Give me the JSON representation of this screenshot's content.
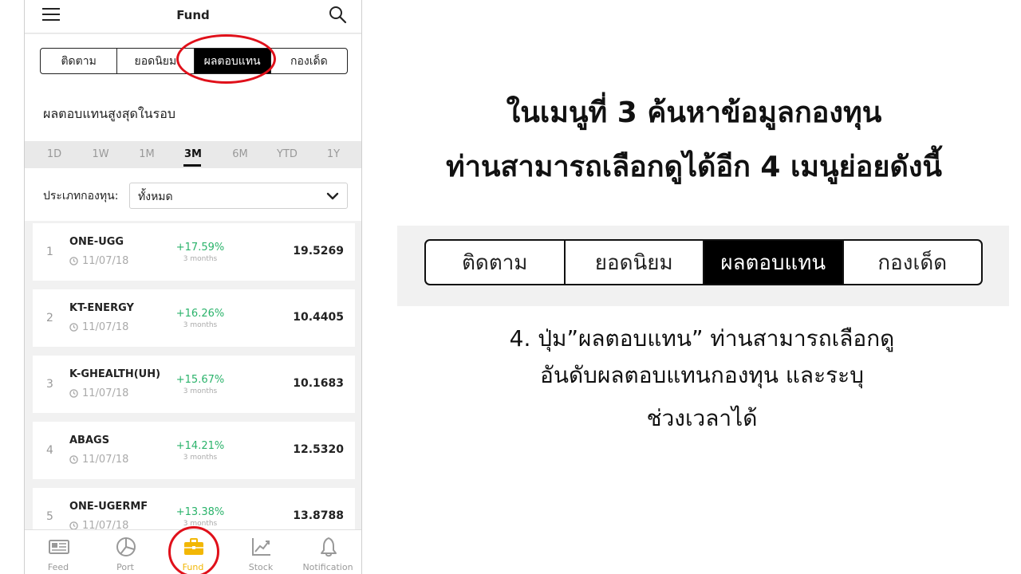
{
  "app": {
    "title": "Fund",
    "tabs": [
      {
        "label": "ติดตาม",
        "active": false
      },
      {
        "label": "ยอดนิยม",
        "active": false
      },
      {
        "label": "ผลตอบแทน",
        "active": true
      },
      {
        "label": "กองเด็ด",
        "active": false
      }
    ],
    "section_title": "ผลตอบแทนสูงสุดในรอบ",
    "periods": [
      {
        "label": "1D",
        "active": false
      },
      {
        "label": "1W",
        "active": false
      },
      {
        "label": "1M",
        "active": false
      },
      {
        "label": "3M",
        "active": true
      },
      {
        "label": "6M",
        "active": false
      },
      {
        "label": "YTD",
        "active": false
      },
      {
        "label": "1Y",
        "active": false
      }
    ],
    "filter": {
      "label": "ประเภทกองทุน:",
      "value": "ทั้งหมด"
    },
    "funds": [
      {
        "rank": "1",
        "name": "ONE-UGG",
        "date": "11/07/18",
        "change": "+17.59%",
        "period": "3 months",
        "nav": "19.5269"
      },
      {
        "rank": "2",
        "name": "KT-ENERGY",
        "date": "11/07/18",
        "change": "+16.26%",
        "period": "3 months",
        "nav": "10.4405"
      },
      {
        "rank": "3",
        "name": "K-GHEALTH(UH)",
        "date": "11/07/18",
        "change": "+15.67%",
        "period": "3 months",
        "nav": "10.1683"
      },
      {
        "rank": "4",
        "name": "ABAGS",
        "date": "11/07/18",
        "change": "+14.21%",
        "period": "3 months",
        "nav": "12.5320"
      },
      {
        "rank": "5",
        "name": "ONE-UGERMF",
        "date": "11/07/18",
        "change": "+13.38%",
        "period": "3 months",
        "nav": "13.8788"
      }
    ],
    "bottom_nav": [
      {
        "label": "Feed",
        "icon": "newspaper-icon",
        "active": false
      },
      {
        "label": "Port",
        "icon": "pie-chart-icon",
        "active": false
      },
      {
        "label": "Fund",
        "icon": "briefcase-icon",
        "active": true
      },
      {
        "label": "Stock",
        "icon": "trend-chart-icon",
        "active": false
      },
      {
        "label": "Notification",
        "icon": "bell-icon",
        "active": false
      }
    ],
    "colors": {
      "positive": "#2bb36b",
      "active_nav": "#f2b705",
      "highlight": "#e0101a"
    }
  },
  "slide": {
    "headline_line1": "ในเมนูที่ 3 ค้นหาข้อมูลกองทุน",
    "headline_line2": "ท่านสามารถเลือกดูได้อีก 4 เมนูย่อยดังนี้",
    "tabs": [
      {
        "label": "ติดตาม",
        "active": false
      },
      {
        "label": "ยอดนิยม",
        "active": false
      },
      {
        "label": "ผลตอบแทน",
        "active": true
      },
      {
        "label": "กองเด็ด",
        "active": false
      }
    ],
    "description_line1": "4. ปุ่ม”ผลตอบแทน” ท่านสามารถเลือกดู",
    "description_line2": "อันดับผลตอบแทนกองทุน และระบุ",
    "description_line3": "ช่วงเวลาได้"
  }
}
